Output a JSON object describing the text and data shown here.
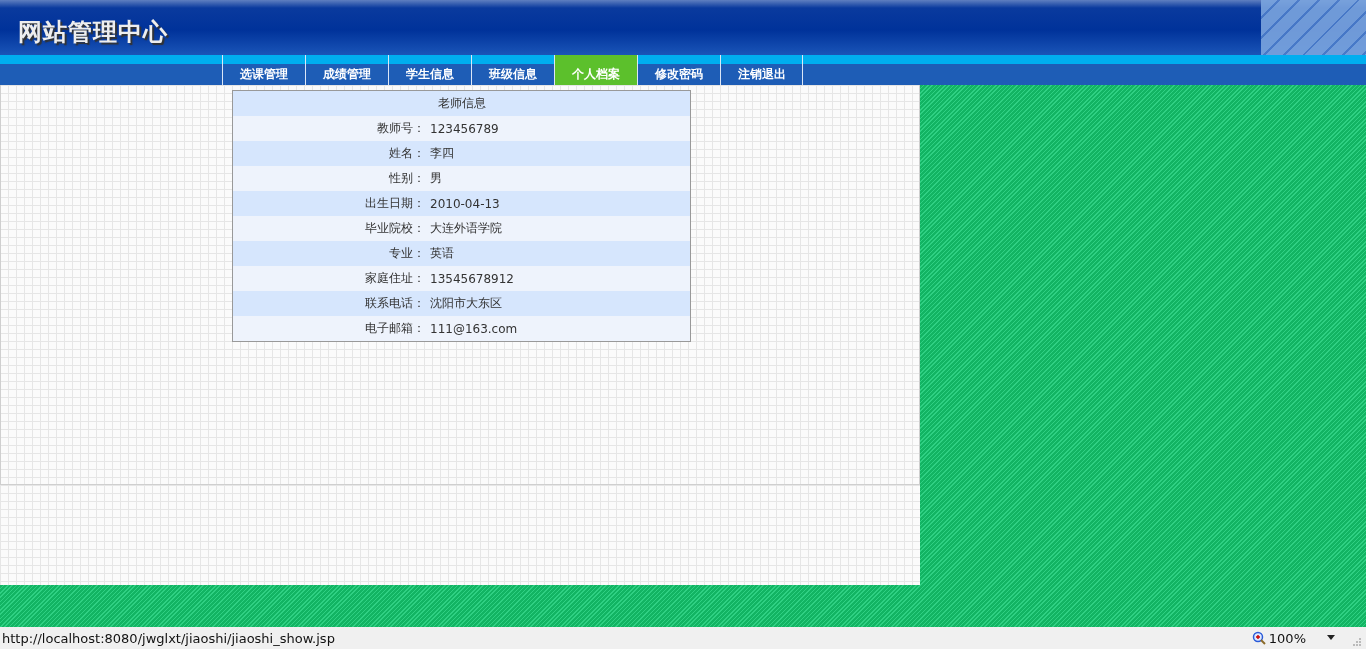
{
  "header": {
    "title": "网站管理中心"
  },
  "nav": [
    {
      "label": "选课管理",
      "selected": false
    },
    {
      "label": "成绩管理",
      "selected": false
    },
    {
      "label": "学生信息",
      "selected": false
    },
    {
      "label": "班级信息",
      "selected": false
    },
    {
      "label": "个人档案",
      "selected": true
    },
    {
      "label": "修改密码",
      "selected": false
    },
    {
      "label": "注销退出",
      "selected": false
    }
  ],
  "info_table": {
    "title": "老师信息",
    "rows": [
      {
        "label": "教师号：",
        "value": "123456789"
      },
      {
        "label": "姓名：",
        "value": "李四"
      },
      {
        "label": "性别：",
        "value": "男"
      },
      {
        "label": "出生日期：",
        "value": "2010-04-13"
      },
      {
        "label": "毕业院校：",
        "value": "大连外语学院"
      },
      {
        "label": "专业：",
        "value": "英语"
      },
      {
        "label": "家庭住址：",
        "value": "13545678912"
      },
      {
        "label": "联系电话：",
        "value": "沈阳市大东区"
      },
      {
        "label": "电子邮箱：",
        "value": "111@163.com"
      }
    ]
  },
  "status_bar": {
    "url": "http://localhost:8080/jwglxt/jiaoshi/jiaoshi_show.jsp",
    "zoom": "100%"
  }
}
